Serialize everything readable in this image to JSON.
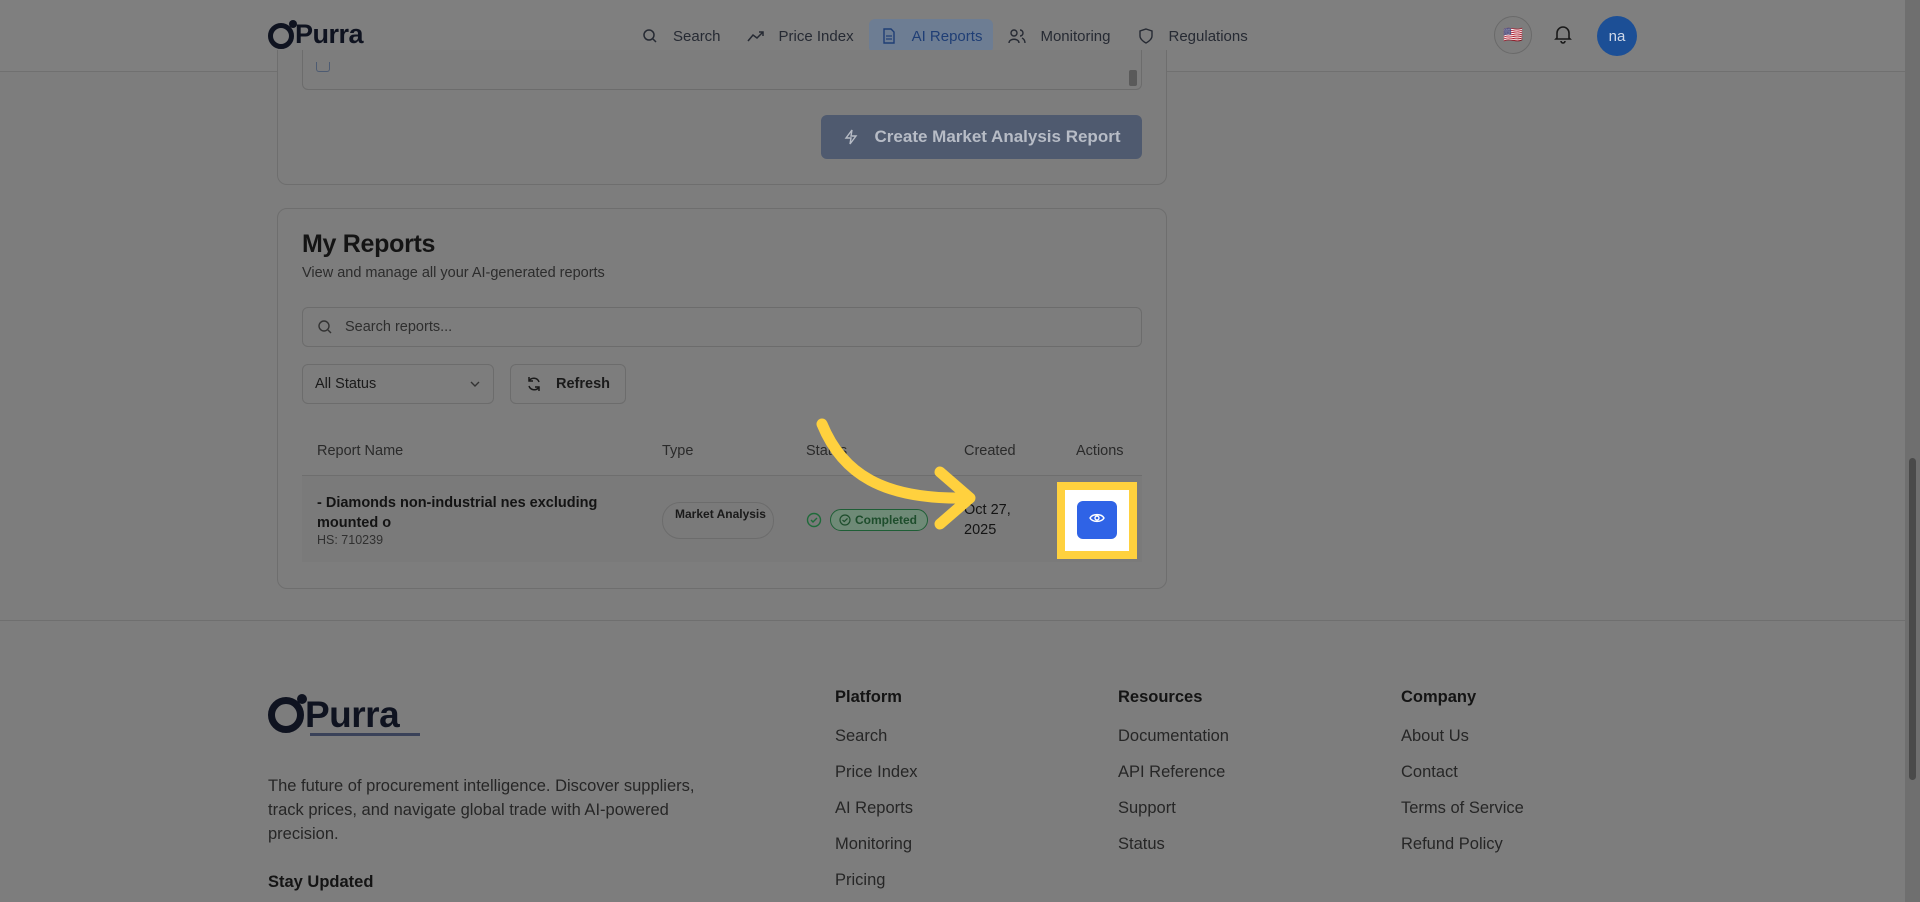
{
  "header": {
    "logo_text": "Purra",
    "nav": [
      {
        "label": "Search",
        "icon": "search-icon"
      },
      {
        "label": "Price Index",
        "icon": "trending-icon"
      },
      {
        "label": "AI Reports",
        "icon": "document-icon",
        "active": true
      },
      {
        "label": "Monitoring",
        "icon": "users-icon"
      },
      {
        "label": "Regulations",
        "icon": "shield-icon"
      }
    ],
    "language_flag": "🇺🇸",
    "avatar_initials": "na"
  },
  "create_card": {
    "button_label": "Create Market Analysis Report"
  },
  "reports": {
    "title": "My Reports",
    "subtitle": "View and manage all your AI-generated reports",
    "search_placeholder": "Search reports...",
    "status_filter": "All Status",
    "refresh_label": "Refresh",
    "columns": [
      "Report Name",
      "Type",
      "Status",
      "Created",
      "Actions"
    ],
    "rows": [
      {
        "name": "- Diamonds non-industrial nes excluding mounted o",
        "hs": "HS: 710239",
        "type": "Market Analysis",
        "status": "Completed",
        "created": "Oct 27, 2025"
      }
    ]
  },
  "footer": {
    "logo_text": "Purra",
    "description": "The future of procurement intelligence. Discover suppliers, track prices, and navigate global trade with AI-powered precision.",
    "stay_updated": "Stay Updated",
    "columns": [
      {
        "title": "Platform",
        "links": [
          "Search",
          "Price Index",
          "AI Reports",
          "Monitoring",
          "Pricing"
        ]
      },
      {
        "title": "Resources",
        "links": [
          "Documentation",
          "API Reference",
          "Support",
          "Status"
        ]
      },
      {
        "title": "Company",
        "links": [
          "About Us",
          "Contact",
          "Terms of Service",
          "Refund Policy"
        ]
      }
    ]
  },
  "colors": {
    "highlight": "#ffd13e",
    "view_button": "#2f63e6",
    "avatar": "#1c4f96"
  }
}
